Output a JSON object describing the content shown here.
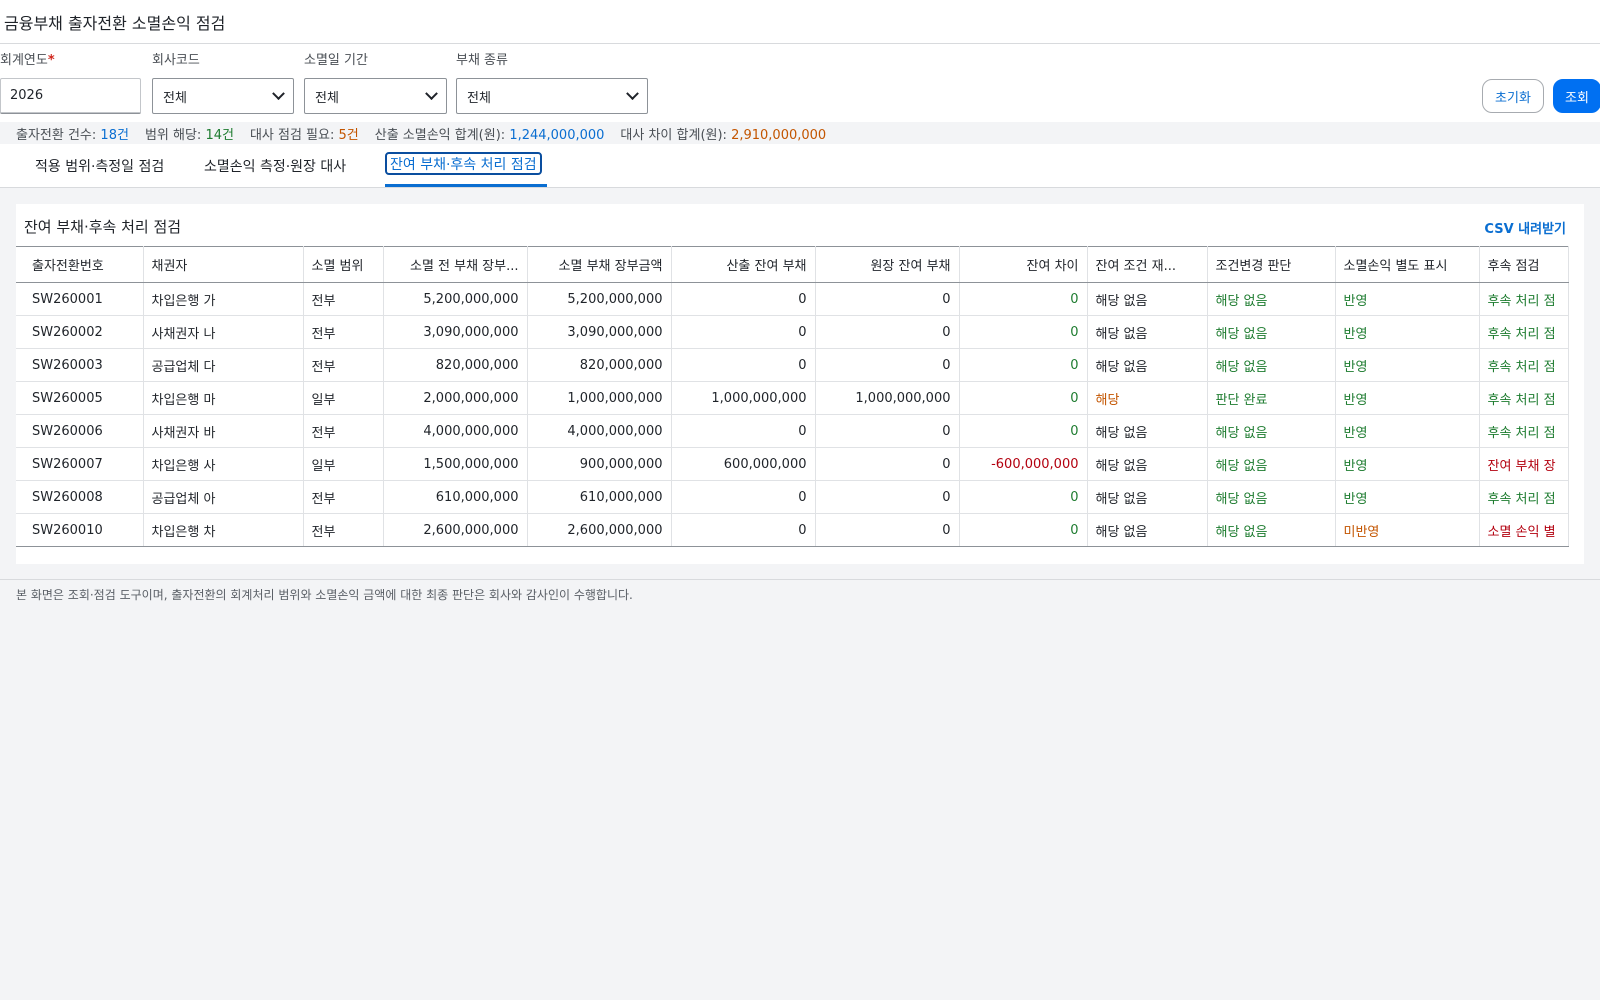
{
  "header": {
    "title": "금융부채 출자전환 소멸손익 점검"
  },
  "filters": {
    "fiscal_year": {
      "label": "회계연도",
      "required_mark": "*",
      "value": "2026"
    },
    "company_code": {
      "label": "회사코드",
      "value": "전체"
    },
    "extinguish_period": {
      "label": "소멸일 기간",
      "value": "전체"
    },
    "liability_type": {
      "label": "부채 종류",
      "value": "전체"
    },
    "reset_label": "초기화",
    "search_label": "조회"
  },
  "summary": {
    "conversions": {
      "label": "출자전환 건수:",
      "value": "18건"
    },
    "in_scope": {
      "label": "범위 해당:",
      "value": "14건"
    },
    "recon_needed": {
      "label": "대사 점검 필요:",
      "value": "5건"
    },
    "calc_total": {
      "label": "산출 소멸손익 합계(원):",
      "value": "1,244,000,000"
    },
    "diff_total": {
      "label": "대사 차이 합계(원):",
      "value": "2,910,000,000"
    }
  },
  "tabs": [
    {
      "label": "적용 범위·측정일 점검"
    },
    {
      "label": "소멸손익 측정·원장 대사"
    },
    {
      "label": "잔여 부채·후속 처리 점검"
    }
  ],
  "panel": {
    "title": "잔여 부채·후속 처리 점검",
    "csv_label": "CSV 내려받기",
    "columns": [
      "출자전환번호",
      "채권자",
      "소멸 범위",
      "소멸 전 부채 장부...",
      "소멸 부채 장부금액",
      "산출 잔여 부채",
      "원장 잔여 부채",
      "잔여 차이",
      "잔여 조건 재...",
      "조건변경 판단",
      "소멸손익 별도 표시",
      "후속 점검"
    ],
    "rows": [
      [
        "SW260001",
        "차입은행 가",
        "전부",
        "5,200,000,000",
        "5,200,000,000",
        "0",
        "0",
        "0",
        "해당 없음",
        "해당 없음",
        "반영",
        "후속 처리 점"
      ],
      [
        "SW260002",
        "사채권자 나",
        "전부",
        "3,090,000,000",
        "3,090,000,000",
        "0",
        "0",
        "0",
        "해당 없음",
        "해당 없음",
        "반영",
        "후속 처리 점"
      ],
      [
        "SW260003",
        "공급업체 다",
        "전부",
        "820,000,000",
        "820,000,000",
        "0",
        "0",
        "0",
        "해당 없음",
        "해당 없음",
        "반영",
        "후속 처리 점"
      ],
      [
        "SW260005",
        "차입은행 마",
        "일부",
        "2,000,000,000",
        "1,000,000,000",
        "1,000,000,000",
        "1,000,000,000",
        "0",
        "해당",
        "판단 완료",
        "반영",
        "후속 처리 점"
      ],
      [
        "SW260006",
        "사채권자 바",
        "전부",
        "4,000,000,000",
        "4,000,000,000",
        "0",
        "0",
        "0",
        "해당 없음",
        "해당 없음",
        "반영",
        "후속 처리 점"
      ],
      [
        "SW260007",
        "차입은행 사",
        "일부",
        "1,500,000,000",
        "900,000,000",
        "600,000,000",
        "0",
        "-600,000,000",
        "해당 없음",
        "해당 없음",
        "반영",
        "잔여 부채 장"
      ],
      [
        "SW260008",
        "공급업체 아",
        "전부",
        "610,000,000",
        "610,000,000",
        "0",
        "0",
        "0",
        "해당 없음",
        "해당 없음",
        "반영",
        "후속 처리 점"
      ],
      [
        "SW260010",
        "차입은행 차",
        "전부",
        "2,600,000,000",
        "2,600,000,000",
        "0",
        "0",
        "0",
        "해당 없음",
        "해당 없음",
        "미반영",
        "소멸 손익 별"
      ]
    ]
  },
  "footnote": "본 화면은 조회·점검 도구이며, 출자전환의 회계처리 범위와 소멸손익 금액에 대한 최종 판단은 회사와 감사인이 수행합니다.",
  "colors": {
    "accent": "#0a6ed1",
    "ok": "#1e7c30",
    "warn": "#c35500",
    "error": "#b3000f"
  }
}
